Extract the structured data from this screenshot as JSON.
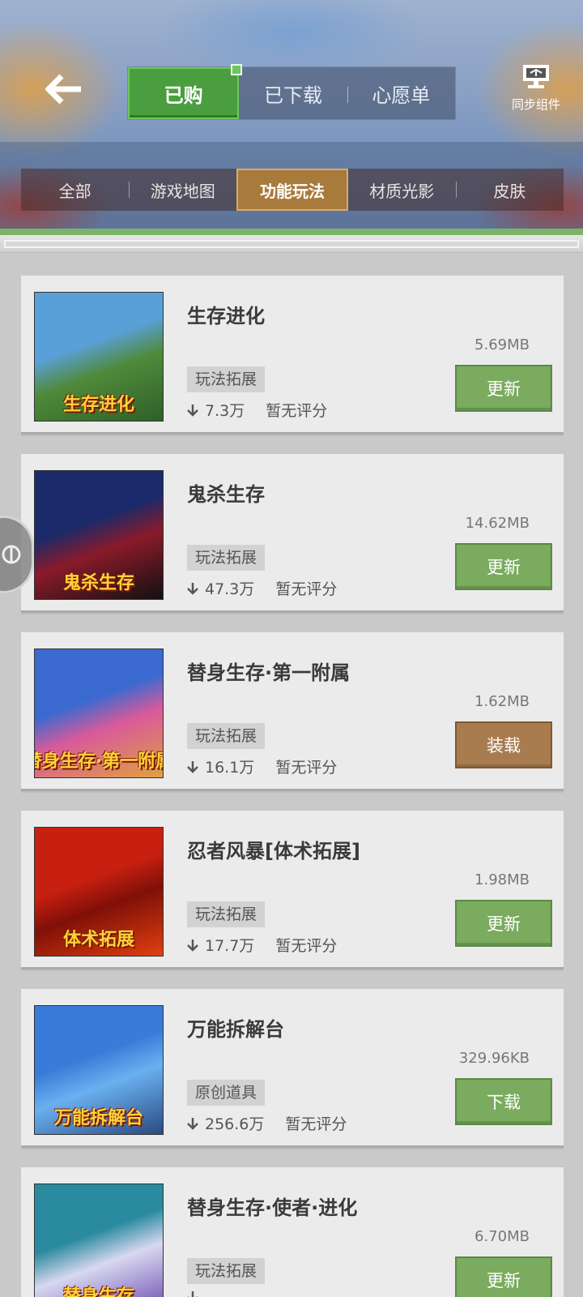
{
  "header": {
    "tabs": [
      {
        "label": "已购",
        "active": true
      },
      {
        "label": "已下载",
        "active": false
      },
      {
        "label": "心愿单",
        "active": false
      }
    ],
    "sync_label": "同步组件"
  },
  "categories": [
    {
      "label": "全部",
      "active": false
    },
    {
      "label": "游戏地图",
      "active": false
    },
    {
      "label": "功能玩法",
      "active": true
    },
    {
      "label": "材质光影",
      "active": false
    },
    {
      "label": "皮肤",
      "active": false
    }
  ],
  "items": [
    {
      "title": "生存进化",
      "size": "5.69MB",
      "tag": "玩法拓展",
      "downloads": "7.3万",
      "rating": "暂无评分",
      "action": "更新",
      "action_color": "green",
      "thumb_text": "生存进化",
      "thumb_colors": [
        "#5aa0d8",
        "#4f8a3a",
        "#2f5f2a"
      ]
    },
    {
      "title": "鬼杀生存",
      "size": "14.62MB",
      "tag": "玩法拓展",
      "downloads": "47.3万",
      "rating": "暂无评分",
      "action": "更新",
      "action_color": "green",
      "thumb_text": "鬼杀生存",
      "thumb_colors": [
        "#1a2a6a",
        "#8a1a2a",
        "#111111"
      ]
    },
    {
      "title": "替身生存·第一附属",
      "size": "1.62MB",
      "tag": "玩法拓展",
      "downloads": "16.1万",
      "rating": "暂无评分",
      "action": "装载",
      "action_color": "brown",
      "thumb_text": "替身生存·第一附属",
      "thumb_colors": [
        "#3a6ad0",
        "#d85a9a",
        "#e0a040"
      ]
    },
    {
      "title": "忍者风暴[体术拓展]",
      "size": "1.98MB",
      "tag": "玩法拓展",
      "downloads": "17.7万",
      "rating": "暂无评分",
      "action": "更新",
      "action_color": "green",
      "thumb_text": "体术拓展",
      "thumb_colors": [
        "#c82010",
        "#801008",
        "#e04010"
      ]
    },
    {
      "title": "万能拆解台",
      "size": "329.96KB",
      "tag": "原创道具",
      "downloads": "256.6万",
      "rating": "暂无评分",
      "action": "下载",
      "action_color": "green",
      "thumb_text": "万能拆解台",
      "thumb_colors": [
        "#3a7ad8",
        "#6ab0f0",
        "#2a4a80"
      ]
    },
    {
      "title": "替身生存·使者·进化",
      "size": "6.70MB",
      "tag": "玩法拓展",
      "downloads": "",
      "rating": "",
      "action": "更新",
      "action_color": "green",
      "thumb_text": "替身生存",
      "thumb_colors": [
        "#2a8aa0",
        "#d8d8f0",
        "#6a4ab0"
      ]
    }
  ],
  "colors": {
    "accent_green": "#4a9e3f",
    "button_green": "#7aab5e",
    "button_brown": "#a97c4f",
    "category_active": "#a87a3c"
  },
  "icons": {
    "back": "back-arrow-icon",
    "sync": "sync-components-icon",
    "download_count": "download-arrow-icon",
    "float": "floating-assistant-icon"
  }
}
